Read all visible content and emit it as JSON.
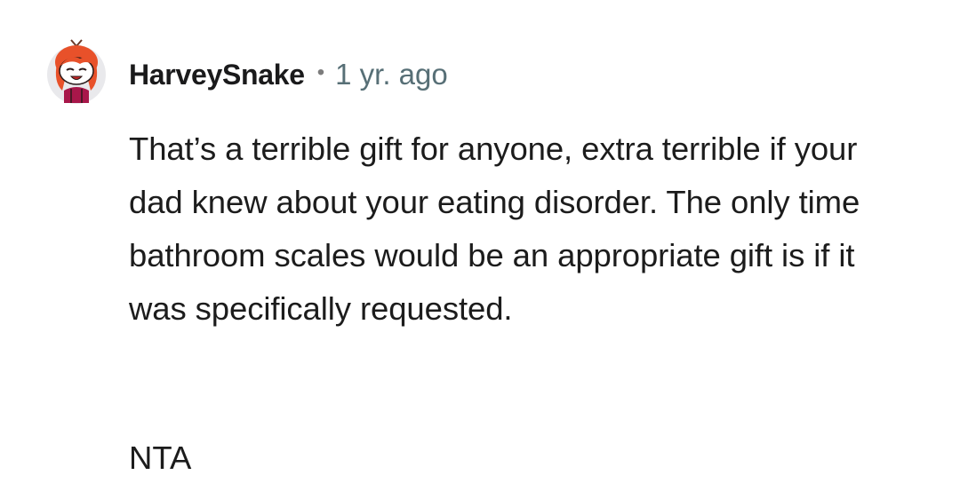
{
  "comment": {
    "avatar_icon": "snoo-avatar-icon",
    "username": "HarveySnake",
    "separator": "•",
    "age": "1 yr. ago",
    "body": "That’s a terrible gift for anyone, extra terrible if your dad knew about your eating disorder. The only time bathroom scales would be an appropriate gift is if it was specifically requested.",
    "verdict": "NTA"
  },
  "colors": {
    "text": "#1c1c1c",
    "meta": "#576f76",
    "avatar_hair": "#e8512a",
    "avatar_bg": "#e9e9ec"
  }
}
